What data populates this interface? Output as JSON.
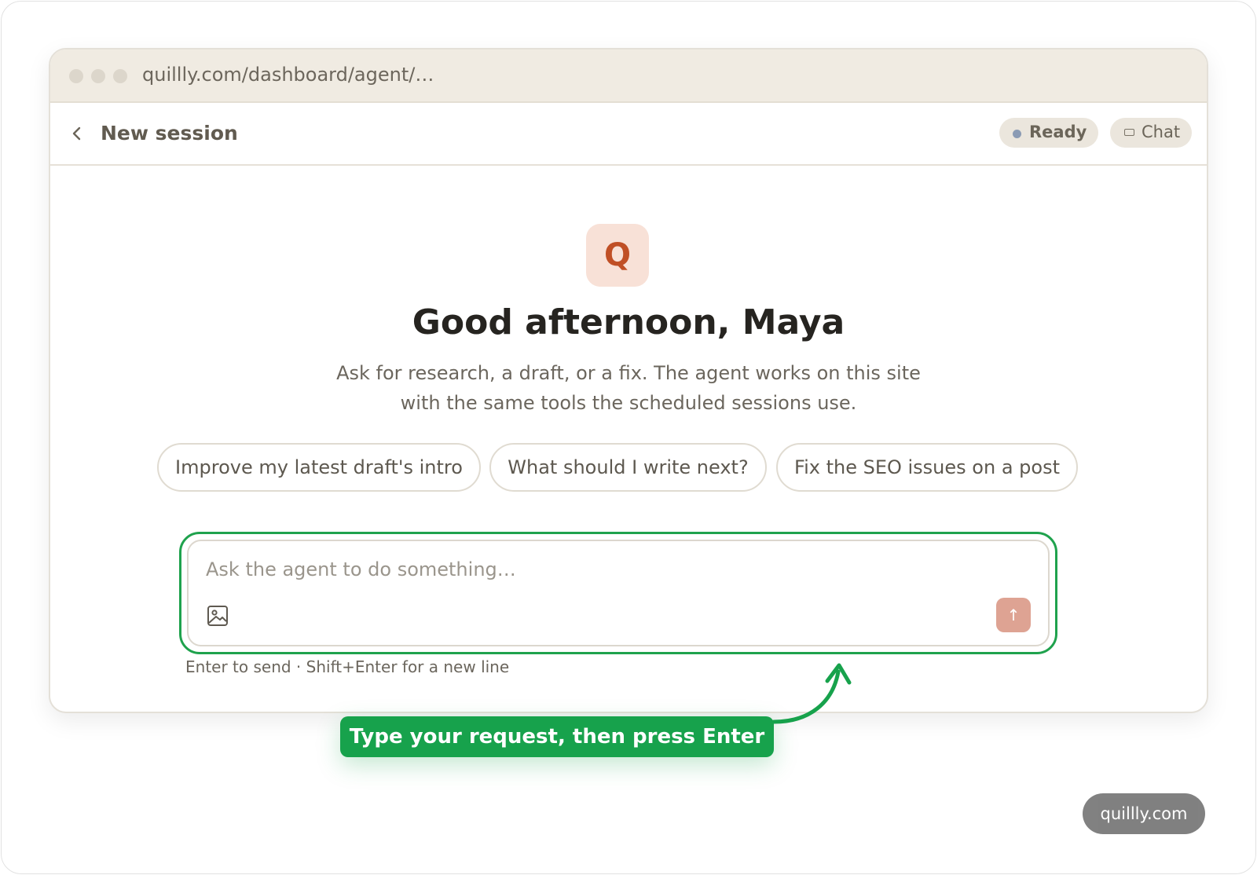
{
  "browser": {
    "url": "quillly.com/dashboard/agent/…"
  },
  "header": {
    "back_icon": "chevron-left-icon",
    "title": "New session",
    "status_label": "Ready",
    "status_color": "#8b9bb4",
    "mode_icon": "chat-icon",
    "mode_label": "Chat"
  },
  "hero": {
    "logo_letter": "Q",
    "greeting": "Good afternoon, Maya",
    "subtitle_line1": "Ask for research, a draft, or a fix. The agent works on this site",
    "subtitle_line2": "with the same tools the scheduled sessions use."
  },
  "suggestions": [
    "Improve my latest draft's intro",
    "What should I write next?",
    "Fix the SEO issues on a post"
  ],
  "composer": {
    "placeholder": "Ask the agent to do something…",
    "value": "",
    "attach_icon": "image-icon",
    "send_icon": "↑",
    "hint": "Enter to send · Shift+Enter for a new line"
  },
  "annotation": {
    "callout": "Type your request, then press Enter",
    "accent": "#17a24c"
  },
  "watermark": "quillly.com"
}
